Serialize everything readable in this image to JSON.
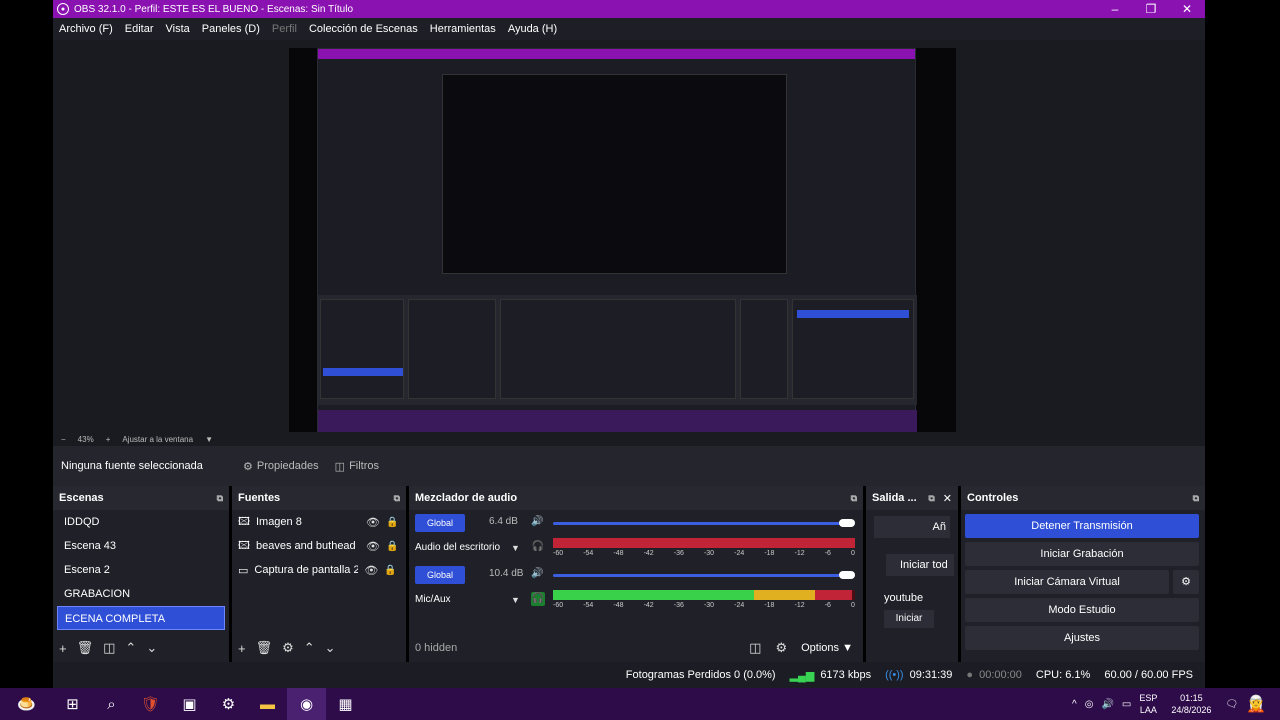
{
  "window": {
    "title": "OBS 32.1.0 - Perfil: ESTE ES EL BUENO - Escenas: Sin Título"
  },
  "menu": [
    "Archivo (F)",
    "Editar",
    "Vista",
    "Paneles (D)",
    "Perfil",
    "Colección de Escenas",
    "Herramientas",
    "Ayuda (H)"
  ],
  "zoom": {
    "percent": "43%",
    "fit_label": "Ajustar a la ventana"
  },
  "properties_bar": {
    "selected_source": "Ninguna fuente seleccionada",
    "properties_label": "Propiedades",
    "filters_label": "Filtros"
  },
  "scenes": {
    "title": "Escenas",
    "items": [
      "IDDQD",
      "Escena 43",
      "Escena 2",
      "GRABACION",
      "ECENA COMPLETA"
    ],
    "selected": "ECENA COMPLETA"
  },
  "sources": {
    "title": "Fuentes",
    "items": [
      "Imagen 8",
      "beaves and buthead",
      "Captura de pantalla 2"
    ]
  },
  "mixer": {
    "title": "Mezclador de audio",
    "channels": [
      {
        "name": "Audio del escritorio",
        "global": "Global",
        "db": "6.4 dB",
        "volume": 1.0,
        "level": 1.0
      },
      {
        "name": "Mic/Aux",
        "global": "Global",
        "db": "10.4 dB",
        "volume": 1.0,
        "level": 0.99
      }
    ],
    "ticks": [
      "-60",
      "-54",
      "-48",
      "-42",
      "-36",
      "-30",
      "-24",
      "-18",
      "-12",
      "-6",
      "0"
    ],
    "hidden_label": "0 hidden",
    "options_label": "Options"
  },
  "output": {
    "title": "Salida ...",
    "add_label": "Añ",
    "start_all_label": "Iniciar tod",
    "service_name": "youtube",
    "start_label": "Iniciar"
  },
  "controls": {
    "title": "Controles",
    "buttons": [
      "Detener Transmisión",
      "Iniciar Grabación",
      "Iniciar Cámara Virtual",
      "Modo Estudio",
      "Ajustes"
    ]
  },
  "status": {
    "dropped_frames": "Fotogramas Perdidos 0 (0.0%)",
    "bitrate": "6173 kbps",
    "stream_time": "09:31:39",
    "rec_time": "00:00:00",
    "cpu": "CPU: 6.1%",
    "fps": "60.00 / 60.00 FPS"
  },
  "taskbar": {
    "lang_top": "ESP",
    "lang_bottom": "LAA",
    "time": "01:15",
    "date": "24/8/2026"
  },
  "colors": {
    "accent": "#2f4fd6",
    "titlebar": "#8a12b0",
    "taskbar": "#2e0c4a"
  }
}
